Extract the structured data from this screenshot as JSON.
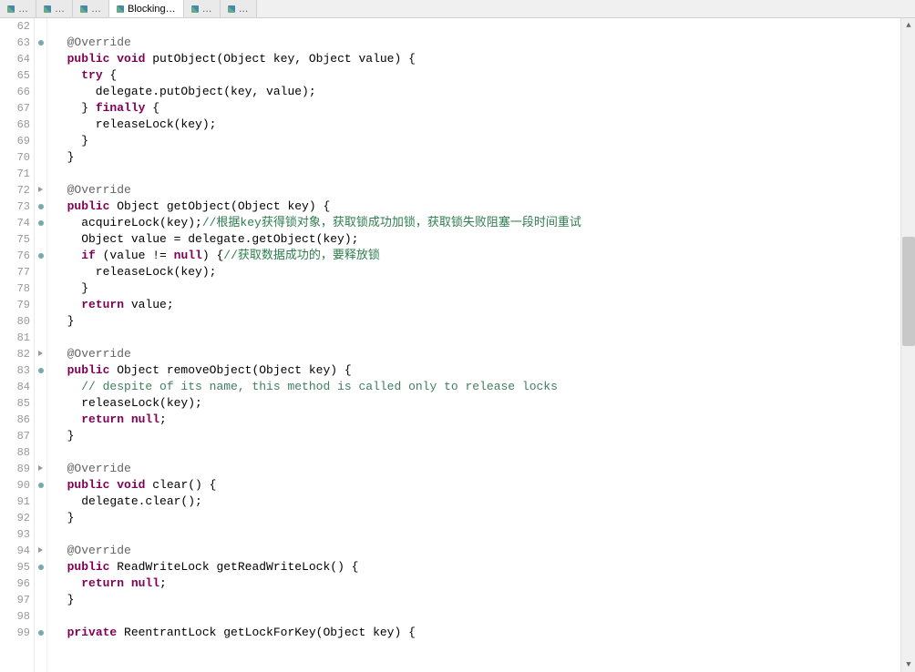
{
  "tabs": [
    {
      "label": "…"
    },
    {
      "label": "…"
    },
    {
      "label": "…"
    },
    {
      "label": "Blocking…",
      "active": true
    },
    {
      "label": "…"
    },
    {
      "label": "…"
    }
  ],
  "gutter": {
    "start": 62,
    "end": 99
  },
  "annotations": {
    "circles": [
      63,
      73,
      74,
      76,
      83,
      90,
      95,
      99
    ],
    "triangles": [
      72,
      82,
      89,
      94
    ]
  },
  "code": [
    {
      "n": 62,
      "t": ""
    },
    {
      "n": 63,
      "t": "  @Override",
      "cls": "ann-txt"
    },
    {
      "n": 64,
      "seg": [
        {
          "t": "  ",
          "c": "plain"
        },
        {
          "t": "public void",
          "c": "kw"
        },
        {
          "t": " putObject(Object key, Object value) {",
          "c": "plain"
        }
      ]
    },
    {
      "n": 65,
      "seg": [
        {
          "t": "    ",
          "c": "plain"
        },
        {
          "t": "try",
          "c": "kw"
        },
        {
          "t": " {",
          "c": "plain"
        }
      ]
    },
    {
      "n": 66,
      "seg": [
        {
          "t": "      delegate.putObject(key, value);",
          "c": "plain"
        }
      ]
    },
    {
      "n": 67,
      "seg": [
        {
          "t": "    } ",
          "c": "plain"
        },
        {
          "t": "finally",
          "c": "kw"
        },
        {
          "t": " {",
          "c": "plain"
        }
      ]
    },
    {
      "n": 68,
      "seg": [
        {
          "t": "      releaseLock(key);",
          "c": "plain"
        }
      ]
    },
    {
      "n": 69,
      "seg": [
        {
          "t": "    }",
          "c": "plain"
        }
      ]
    },
    {
      "n": 70,
      "seg": [
        {
          "t": "  }",
          "c": "plain"
        }
      ]
    },
    {
      "n": 71,
      "t": ""
    },
    {
      "n": 72,
      "t": "  @Override",
      "cls": "ann-txt"
    },
    {
      "n": 73,
      "seg": [
        {
          "t": "  ",
          "c": "plain"
        },
        {
          "t": "public",
          "c": "kw"
        },
        {
          "t": " Object getObject(Object key) {",
          "c": "plain"
        }
      ]
    },
    {
      "n": 74,
      "seg": [
        {
          "t": "    acquireLock(key);",
          "c": "plain"
        },
        {
          "t": "//根据key获得锁对象，获取锁成功加锁，获取锁失败阻塞一段时间重试",
          "c": "com-cn"
        }
      ]
    },
    {
      "n": 75,
      "seg": [
        {
          "t": "    Object value = delegate.getObject(key);",
          "c": "plain"
        }
      ]
    },
    {
      "n": 76,
      "seg": [
        {
          "t": "    ",
          "c": "plain"
        },
        {
          "t": "if",
          "c": "kw"
        },
        {
          "t": " (value != ",
          "c": "plain"
        },
        {
          "t": "null",
          "c": "kw"
        },
        {
          "t": ") {",
          "c": "plain"
        },
        {
          "t": "//获取数据成功的，要释放锁",
          "c": "com-cn"
        }
      ]
    },
    {
      "n": 77,
      "seg": [
        {
          "t": "      releaseLock(key);",
          "c": "plain"
        }
      ]
    },
    {
      "n": 78,
      "seg": [
        {
          "t": "    }",
          "c": "plain"
        }
      ]
    },
    {
      "n": 79,
      "seg": [
        {
          "t": "    ",
          "c": "plain"
        },
        {
          "t": "return",
          "c": "kw"
        },
        {
          "t": " value;",
          "c": "plain"
        }
      ]
    },
    {
      "n": 80,
      "seg": [
        {
          "t": "  }",
          "c": "plain"
        }
      ]
    },
    {
      "n": 81,
      "t": ""
    },
    {
      "n": 82,
      "t": "  @Override",
      "cls": "ann-txt"
    },
    {
      "n": 83,
      "seg": [
        {
          "t": "  ",
          "c": "plain"
        },
        {
          "t": "public",
          "c": "kw"
        },
        {
          "t": " Object removeObject(Object key) {",
          "c": "plain"
        }
      ]
    },
    {
      "n": 84,
      "seg": [
        {
          "t": "    ",
          "c": "plain"
        },
        {
          "t": "// despite of its name, this method is called only to release locks",
          "c": "com"
        }
      ]
    },
    {
      "n": 85,
      "seg": [
        {
          "t": "    releaseLock(key);",
          "c": "plain"
        }
      ]
    },
    {
      "n": 86,
      "seg": [
        {
          "t": "    ",
          "c": "plain"
        },
        {
          "t": "return null",
          "c": "kw"
        },
        {
          "t": ";",
          "c": "plain"
        }
      ]
    },
    {
      "n": 87,
      "seg": [
        {
          "t": "  }",
          "c": "plain"
        }
      ]
    },
    {
      "n": 88,
      "t": ""
    },
    {
      "n": 89,
      "t": "  @Override",
      "cls": "ann-txt"
    },
    {
      "n": 90,
      "seg": [
        {
          "t": "  ",
          "c": "plain"
        },
        {
          "t": "public void",
          "c": "kw"
        },
        {
          "t": " clear() {",
          "c": "plain"
        }
      ]
    },
    {
      "n": 91,
      "seg": [
        {
          "t": "    delegate.clear();",
          "c": "plain"
        }
      ]
    },
    {
      "n": 92,
      "seg": [
        {
          "t": "  }",
          "c": "plain"
        }
      ]
    },
    {
      "n": 93,
      "t": ""
    },
    {
      "n": 94,
      "t": "  @Override",
      "cls": "ann-txt"
    },
    {
      "n": 95,
      "seg": [
        {
          "t": "  ",
          "c": "plain"
        },
        {
          "t": "public",
          "c": "kw"
        },
        {
          "t": " ReadWriteLock getReadWriteLock() {",
          "c": "plain"
        }
      ]
    },
    {
      "n": 96,
      "seg": [
        {
          "t": "    ",
          "c": "plain"
        },
        {
          "t": "return null",
          "c": "kw"
        },
        {
          "t": ";",
          "c": "plain"
        }
      ]
    },
    {
      "n": 97,
      "seg": [
        {
          "t": "  }",
          "c": "plain"
        }
      ]
    },
    {
      "n": 98,
      "t": ""
    },
    {
      "n": 99,
      "seg": [
        {
          "t": "  ",
          "c": "plain"
        },
        {
          "t": "private",
          "c": "kw"
        },
        {
          "t": " ReentrantLock getLockForKey(Object key) {",
          "c": "plain"
        }
      ]
    }
  ],
  "scrollbar": {
    "thumbTop": 240,
    "thumbHeight": 120
  }
}
